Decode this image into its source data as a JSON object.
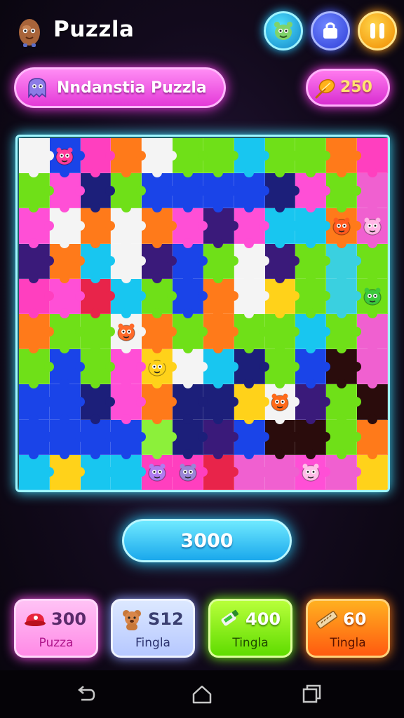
{
  "header": {
    "title": "Puzzla",
    "buttons": [
      {
        "icon": "monster-icon"
      },
      {
        "icon": "shop-bag-icon"
      },
      {
        "icon": "pause-icon"
      }
    ]
  },
  "puzzle": {
    "name": "Nndanstia Puzzla",
    "icon": "ghost-icon",
    "coins": "250",
    "coin_icon": "golden-leaf-icon"
  },
  "board": {
    "rows": 10,
    "cols": 12,
    "palette": {
      "W": "#f4f4f4",
      "P": "#ff3fbf",
      "M": "#ff4fd6",
      "O": "#ff7a1a",
      "G": "#6fe018",
      "L": "#8cf03a",
      "C": "#18c6f0",
      "B": "#1a44e8",
      "N": "#1c1f7a",
      "V": "#3a1a7a",
      "R": "#e8244a",
      "Y": "#ffd21a",
      "D": "#2a0c0c",
      "K": "#f060d0",
      "T": "#3ad0e0"
    },
    "tiles": [
      "WBPOWGGCGGOP",
      "GMNGBBBBNMGK",
      "MWOWOMVMCCOK",
      "VOCWVBGWVGTG",
      "PMRCGBOWYGTG",
      "OGGWOGOGGCGK",
      "GBGMYWCNGBDK",
      "BBNMONNYWVGD",
      "BBBBLNVBDDGO",
      "CYCCPPRKKMKY"
    ],
    "critters": [
      {
        "row": 0,
        "col": 1,
        "icon": "pink-monster-icon",
        "color": "#ff3c9a"
      },
      {
        "row": 2,
        "col": 10,
        "icon": "orange-monster-icon",
        "color": "#ff5a1e"
      },
      {
        "row": 2,
        "col": 11,
        "icon": "pink-blob-icon",
        "color": "#ffb6e6"
      },
      {
        "row": 4,
        "col": 11,
        "icon": "green-blob-icon",
        "color": "#3cc83c"
      },
      {
        "row": 5,
        "col": 3,
        "icon": "orange-critter-icon",
        "color": "#ff6a2a"
      },
      {
        "row": 6,
        "col": 4,
        "icon": "yellow-blob-icon",
        "color": "#ffd21a"
      },
      {
        "row": 7,
        "col": 8,
        "icon": "orange-monster-icon",
        "color": "#ff6a1a"
      },
      {
        "row": 9,
        "col": 4,
        "icon": "purple-cat-icon",
        "color": "#b07cf0"
      },
      {
        "row": 9,
        "col": 5,
        "icon": "lilac-cat-icon",
        "color": "#9a86d6"
      },
      {
        "row": 9,
        "col": 9,
        "icon": "pink-ghost-icon",
        "color": "#ffc0e8"
      }
    ]
  },
  "score": "3000",
  "items": [
    {
      "value": "300",
      "label": "Puzza",
      "icon": "red-cap-icon"
    },
    {
      "value": "S12",
      "label": "Fingla",
      "icon": "teddy-bear-icon"
    },
    {
      "value": "400",
      "label": "Tingla",
      "icon": "glue-tube-icon"
    },
    {
      "value": "60",
      "label": "Tingla",
      "icon": "ruler-icon"
    }
  ],
  "navbar": {
    "back_icon": "back-arrow-icon",
    "home_icon": "home-icon",
    "recents_icon": "recent-apps-icon"
  }
}
